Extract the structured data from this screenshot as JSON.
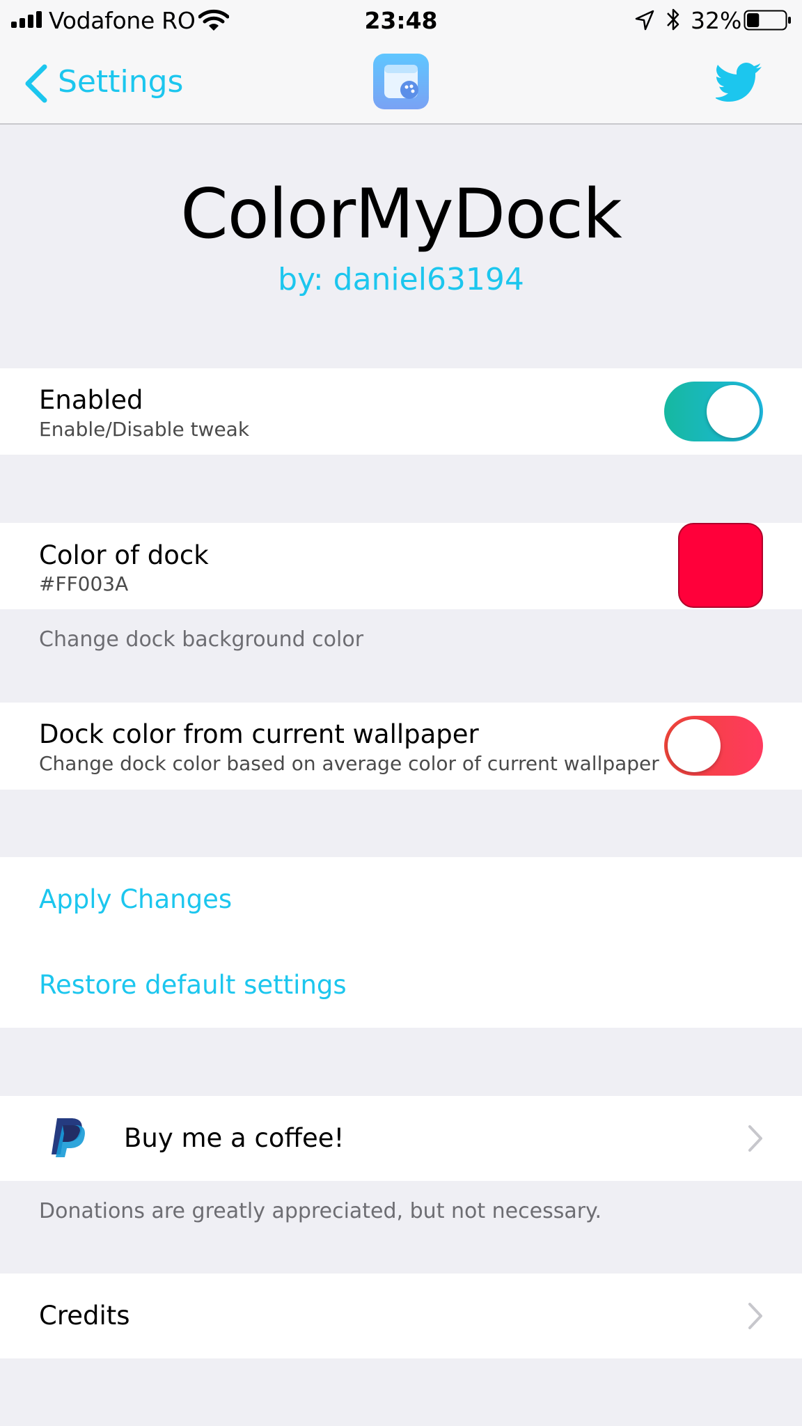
{
  "status_bar": {
    "carrier": "Vodafone RO",
    "time": "23:48",
    "battery_percent": "32%",
    "battery_level": 0.32,
    "icons": [
      "signal-bars-icon",
      "wifi-icon",
      "location-arrow-icon",
      "bluetooth-icon",
      "battery-icon"
    ]
  },
  "nav": {
    "back_label": "Settings",
    "center_icon": "app-icon",
    "right_icon": "twitter-icon"
  },
  "header": {
    "title": "ColorMyDock",
    "subtitle": "by: daniel63194"
  },
  "enabled_cell": {
    "title": "Enabled",
    "subtitle": "Enable/Disable tweak",
    "toggle_on": true
  },
  "color_cell": {
    "title": "Color of dock",
    "value": "#FF003A",
    "swatch_color": "#FF003A",
    "footer": "Change dock background color"
  },
  "wallpaper_cell": {
    "title": "Dock color from current wallpaper",
    "subtitle": "Change dock color based on average color of current wallpaper",
    "toggle_on": false
  },
  "actions": {
    "apply": "Apply Changes",
    "restore": "Restore default settings"
  },
  "donate": {
    "label": "Buy me a coffee!",
    "icon": "paypal-icon",
    "footer": "Donations are greatly appreciated, but not necessary."
  },
  "credits": {
    "label": "Credits"
  },
  "colors": {
    "accent": "#1CC6EE",
    "toggle_on_start": "#16B8A0",
    "toggle_on_end": "#1DB9E0",
    "toggle_off_start": "#F0453A",
    "toggle_off_end": "#FF3A5E",
    "background": "#EFEFF4"
  }
}
